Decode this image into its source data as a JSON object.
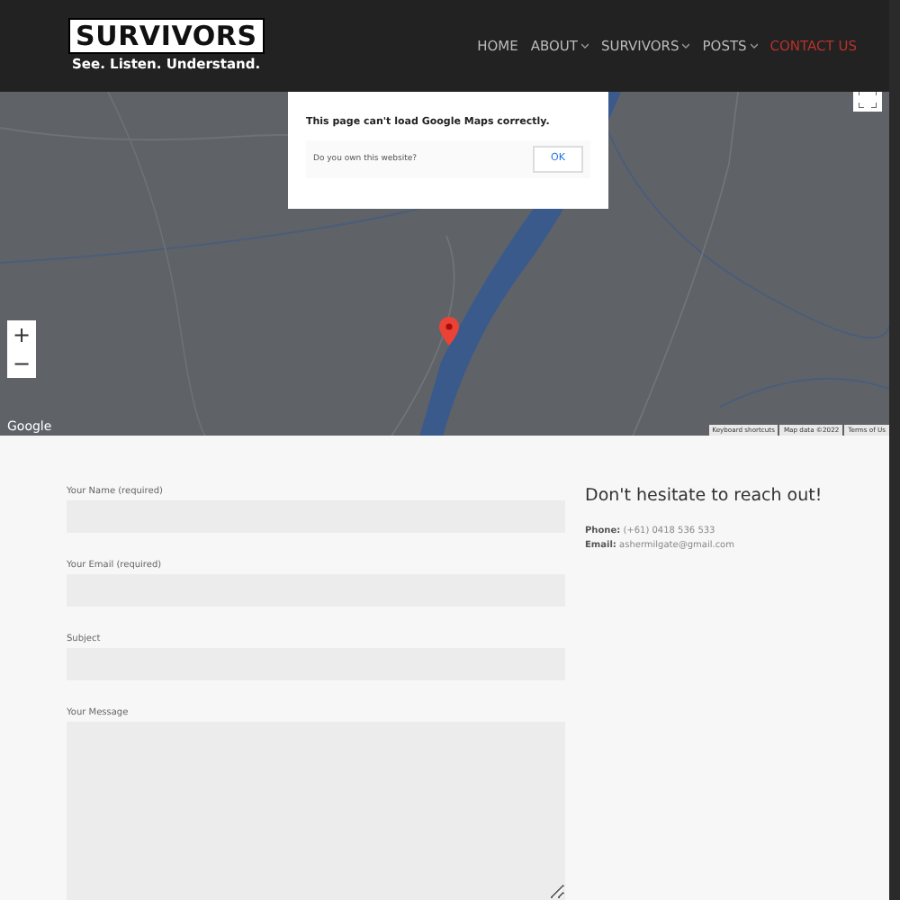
{
  "header": {
    "logo_title": "SURVIVORS",
    "logo_tagline": "See. Listen. Understand.",
    "nav": [
      {
        "label": "HOME",
        "dropdown": false,
        "selected": false
      },
      {
        "label": "ABOUT",
        "dropdown": true,
        "selected": false
      },
      {
        "label": "SURVIVORS",
        "dropdown": true,
        "selected": false
      },
      {
        "label": "POSTS",
        "dropdown": true,
        "selected": false
      },
      {
        "label": "CONTACT US",
        "dropdown": false,
        "selected": true
      }
    ]
  },
  "map": {
    "kind": "picture",
    "dialog": {
      "message": "This page can't load Google Maps correctly.",
      "question": "Do you own this website?",
      "button": "OK"
    },
    "zoom_in": "+",
    "zoom_out": "−",
    "brand": "Google",
    "attribution": [
      "Keyboard shortcuts",
      "Map data ©2022",
      "Terms of Us"
    ]
  },
  "form": {
    "fields": [
      {
        "label": "Your Name (required)",
        "kind": "input"
      },
      {
        "label": "Your Email (required)",
        "kind": "input"
      },
      {
        "label": "Subject",
        "kind": "input"
      },
      {
        "label": "Your Message",
        "kind": "textarea"
      }
    ]
  },
  "contact": {
    "heading": "Don't hesitate to reach out!",
    "lines": [
      {
        "label": "Phone:",
        "value": "(+61) 0418 536 533"
      },
      {
        "label": "Email:",
        "value": "ashermilgate@gmail.com"
      }
    ]
  }
}
